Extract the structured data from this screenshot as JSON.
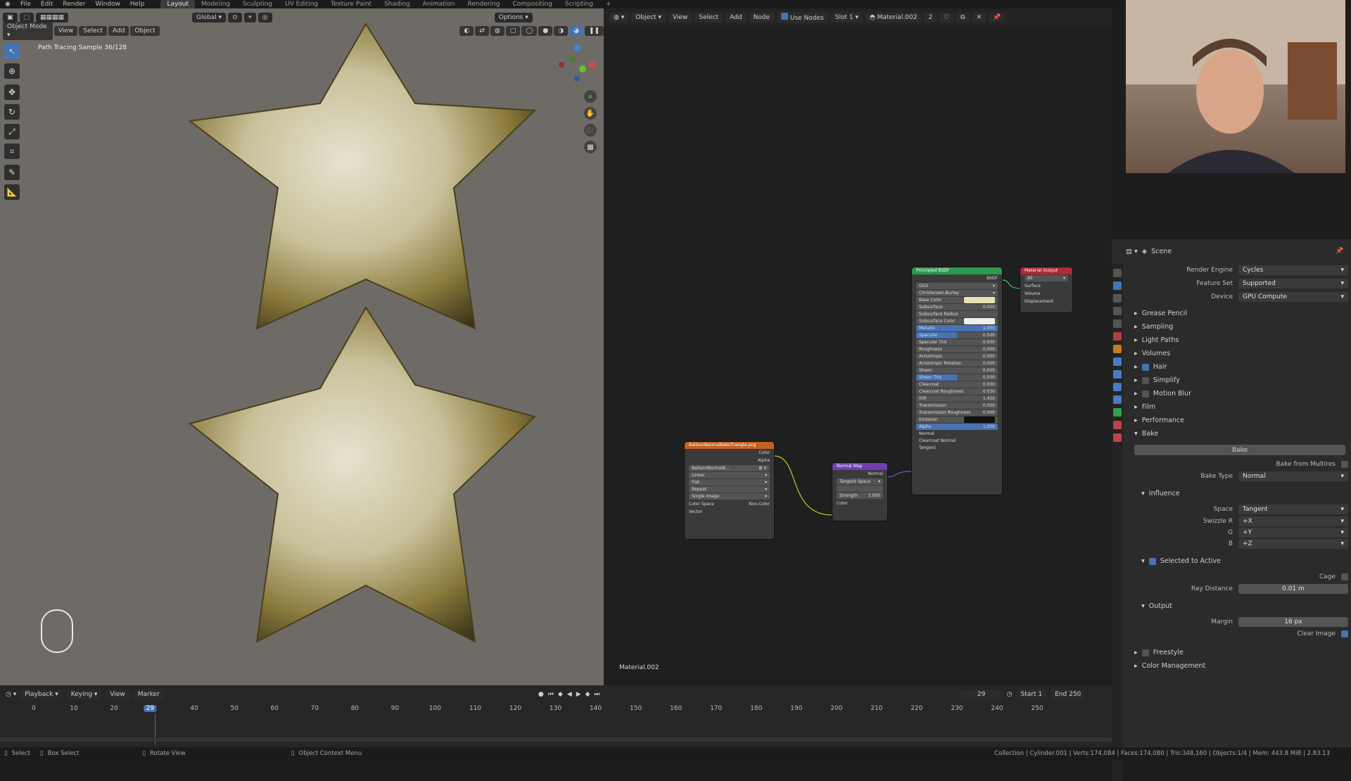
{
  "menus": [
    "File",
    "Edit",
    "Render",
    "Window",
    "Help"
  ],
  "workspace_tabs": [
    "Layout",
    "Modeling",
    "Sculpting",
    "UV Editing",
    "Texture Paint",
    "Shading",
    "Animation",
    "Rendering",
    "Compositing",
    "Scripting"
  ],
  "active_workspace": "Layout",
  "viewport": {
    "mode": "Object Mode",
    "menus": [
      "View",
      "Select",
      "Add",
      "Object"
    ],
    "transform_orientation": "Global",
    "options": "Options",
    "overlay_text": "Path Tracing Sample 36/128"
  },
  "node_editor": {
    "object_label": "Object",
    "menus": [
      "View",
      "Select",
      "Add",
      "Node"
    ],
    "use_nodes": "Use Nodes",
    "slot": "Slot 1",
    "material": "Material.002",
    "users": "2",
    "footer_label": "Material.002",
    "nodes": {
      "image": {
        "title": "BalloonNormalBakeTriangle.png",
        "out_color": "Color",
        "out_alpha": "Alpha",
        "image_name": "BalloonNormalB...",
        "interpolation": "Linear",
        "projection": "Flat",
        "extension": "Repeat",
        "source": "Single Image",
        "color_space_label": "Color Space",
        "color_space": "Non-Color",
        "vector": "Vector"
      },
      "normal_map": {
        "title": "Normal Map",
        "out_normal": "Normal",
        "space": "Tangent Space",
        "strength_label": "Strength",
        "strength": "1.000",
        "color": "Color"
      },
      "bsdf": {
        "title": "Principled BSDF",
        "out": "BSDF",
        "distribution": "GGX",
        "subsurface_method": "Christensen-Burley",
        "rows": [
          {
            "label": "Base Color",
            "value": ""
          },
          {
            "label": "Subsurface",
            "value": "0.000"
          },
          {
            "label": "Subsurface Radius",
            "value": ""
          },
          {
            "label": "Subsurface Color",
            "value": ""
          },
          {
            "label": "Metallic",
            "value": "1.000"
          },
          {
            "label": "Specular",
            "value": "0.500"
          },
          {
            "label": "Specular Tint",
            "value": "0.000"
          },
          {
            "label": "Roughness",
            "value": "0.000"
          },
          {
            "label": "Anisotropic",
            "value": "0.000"
          },
          {
            "label": "Anisotropic Rotation",
            "value": "0.000"
          },
          {
            "label": "Sheen",
            "value": "0.000"
          },
          {
            "label": "Sheen Tint",
            "value": "0.500"
          },
          {
            "label": "Clearcoat",
            "value": "0.000"
          },
          {
            "label": "Clearcoat Roughness",
            "value": "0.030"
          },
          {
            "label": "IOR",
            "value": "1.450"
          },
          {
            "label": "Transmission",
            "value": "0.000"
          },
          {
            "label": "Transmission Roughness",
            "value": "0.000"
          },
          {
            "label": "Emission",
            "value": ""
          },
          {
            "label": "Alpha",
            "value": "1.000"
          },
          {
            "label": "Normal",
            "value": ""
          },
          {
            "label": "Clearcoat Normal",
            "value": ""
          },
          {
            "label": "Tangent",
            "value": ""
          }
        ]
      },
      "output": {
        "title": "Material Output",
        "target": "All",
        "inputs": [
          "Surface",
          "Volume",
          "Displacement"
        ]
      }
    }
  },
  "properties": {
    "scene": "Scene",
    "render_engine_label": "Render Engine",
    "render_engine": "Cycles",
    "feature_set_label": "Feature Set",
    "feature_set": "Supported",
    "device_label": "Device",
    "device": "GPU Compute",
    "panels": [
      "Grease Pencil",
      "Sampling",
      "Light Paths",
      "Volumes",
      "Hair",
      "Simplify",
      "Motion Blur",
      "Film",
      "Performance",
      "Bake"
    ],
    "bake_button": "Bake",
    "bake_from_multires": "Bake from Multires",
    "bake_type_label": "Bake Type",
    "bake_type": "Normal",
    "influence": "Influence",
    "space_label": "Space",
    "space": "Tangent",
    "swizzle_r_label": "Swizzle R",
    "swizzle_r": "+X",
    "g_label": "G",
    "g": "+Y",
    "b_label": "B",
    "b": "+Z",
    "selected_to_active": "Selected to Active",
    "cage": "Cage",
    "ray_distance_label": "Ray Distance",
    "ray_distance": "0.01 m",
    "output": "Output",
    "margin_label": "Margin",
    "margin": "16 px",
    "clear_image": "Clear Image",
    "freestyle": "Freestyle",
    "color_management": "Color Management"
  },
  "timeline": {
    "menus": [
      "Playback",
      "Keying",
      "View",
      "Marker"
    ],
    "current_frame": "29",
    "start_label": "Start",
    "start": "1",
    "end_label": "End",
    "end": "250",
    "frames": [
      "0",
      "10",
      "20",
      "29",
      "40",
      "50",
      "60",
      "70",
      "80",
      "90",
      "100",
      "110",
      "120",
      "130",
      "140",
      "150",
      "160",
      "170",
      "180",
      "190",
      "200",
      "210",
      "220",
      "230",
      "240",
      "250"
    ]
  },
  "status": {
    "select": "Select",
    "box_select": "Box Select",
    "rotate_view": "Rotate View",
    "context_menu": "Object Context Menu",
    "stats": "Collection | Cylinder.001 | Verts:174,084 | Faces:174,080 | Tris:348,160 | Objects:1/4 | Mem: 443.8 MiB | 2.83.13"
  },
  "colors": {
    "accent": "#4772b3",
    "bsdf_header": "#2c9a4f",
    "output_header": "#b02a37",
    "image_header": "#c4611f",
    "vector_header": "#6f3fb2"
  }
}
